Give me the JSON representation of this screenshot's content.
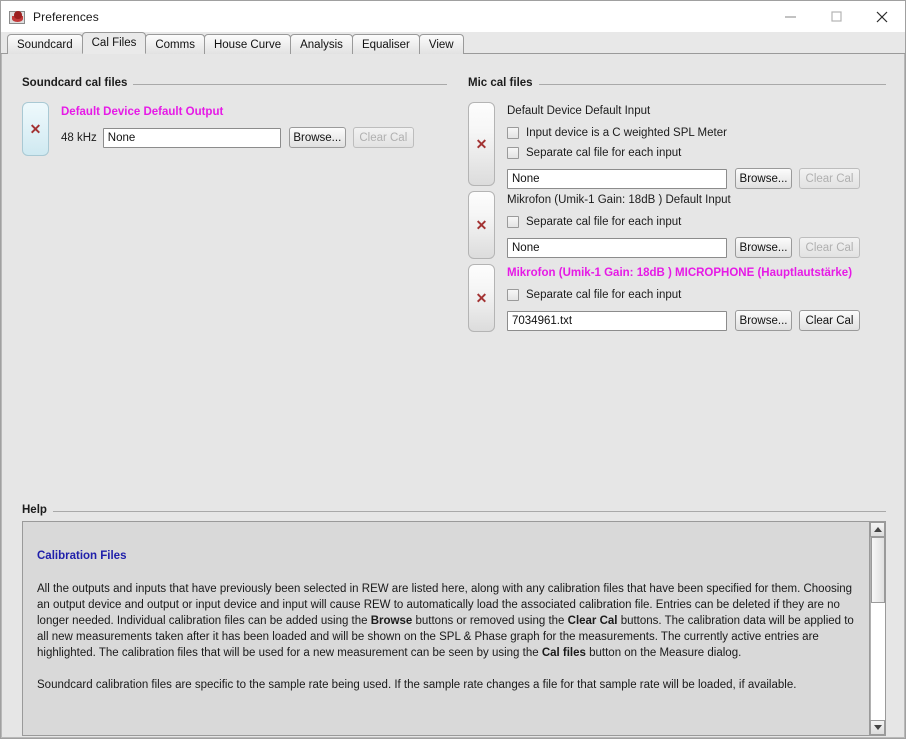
{
  "window": {
    "title": "Preferences",
    "icon": "rew-app-icon",
    "controls": {
      "minimize": "minimize-icon",
      "maximize": "maximize-icon",
      "close": "close-icon"
    }
  },
  "tabs": [
    {
      "label": "Soundcard",
      "active": false
    },
    {
      "label": "Cal Files",
      "active": true
    },
    {
      "label": "Comms",
      "active": false
    },
    {
      "label": "House Curve",
      "active": false
    },
    {
      "label": "Analysis",
      "active": false
    },
    {
      "label": "Equaliser",
      "active": false
    },
    {
      "label": "View",
      "active": false
    }
  ],
  "soundcard_group": {
    "title": "Soundcard cal files",
    "entries": [
      {
        "device": "Default Device Default Output",
        "highlighted": true,
        "sample_rate": "48 kHz",
        "cal_file": "None",
        "browse_label": "Browse...",
        "clear_label": "Clear Cal",
        "clear_disabled": true,
        "delete_icon": "x-delete-icon"
      }
    ]
  },
  "mic_group": {
    "title": "Mic cal files",
    "entries": [
      {
        "device": "Default Device Default Input",
        "highlighted": false,
        "checkboxes": [
          {
            "label": "Input device is a C weighted SPL Meter",
            "checked": false
          },
          {
            "label": "Separate cal file for each input",
            "checked": false
          }
        ],
        "cal_file": "None",
        "browse_label": "Browse...",
        "clear_label": "Clear Cal",
        "clear_disabled": true,
        "delete_icon": "x-delete-icon"
      },
      {
        "device": "Mikrofon (Umik-1  Gain: 18dB  ) Default Input",
        "highlighted": false,
        "checkboxes": [
          {
            "label": "Separate cal file for each input",
            "checked": false
          }
        ],
        "cal_file": "None",
        "browse_label": "Browse...",
        "clear_label": "Clear Cal",
        "clear_disabled": true,
        "delete_icon": "x-delete-icon"
      },
      {
        "device": "Mikrofon (Umik-1  Gain: 18dB  ) MICROPHONE (Hauptlautstärke)",
        "highlighted": true,
        "checkboxes": [
          {
            "label": "Separate cal file for each input",
            "checked": false
          }
        ],
        "cal_file": "7034961.txt",
        "browse_label": "Browse...",
        "clear_label": "Clear Cal",
        "clear_disabled": false,
        "delete_icon": "x-delete-icon"
      }
    ]
  },
  "help": {
    "title": "Help",
    "heading": "Calibration Files",
    "paragraph1_a": "All the outputs and inputs that have previously been selected in REW are listed here, along with any calibration files that have been specified for them. Choosing an output device and output or input device and input will cause REW to automatically load the associated calibration file. Entries can be deleted if they are no longer needed. Individual calibration files can be added using the ",
    "paragraph1_b": "Browse",
    "paragraph1_c": " buttons or removed using the ",
    "paragraph1_d": "Clear Cal",
    "paragraph1_e": " buttons. The calibration data will be applied to all new measurements taken after it has been loaded and will be shown on the SPL & Phase graph for the measurements. The currently active entries are highlighted. The calibration files that will be used for a new measurement can be seen by using the ",
    "paragraph1_f": "Cal files",
    "paragraph1_g": " button on the Measure dialog.",
    "paragraph2": "Soundcard calibration files are specific to the sample rate being used. If the sample rate changes a file for that sample rate will be loaded, if available.",
    "scroll_up_icon": "scroll-up-arrow-icon",
    "scroll_down_icon": "scroll-down-arrow-icon"
  },
  "colors": {
    "highlight": "#e61ae6",
    "help_heading": "#2020aa",
    "delete_x": "#a33333"
  }
}
